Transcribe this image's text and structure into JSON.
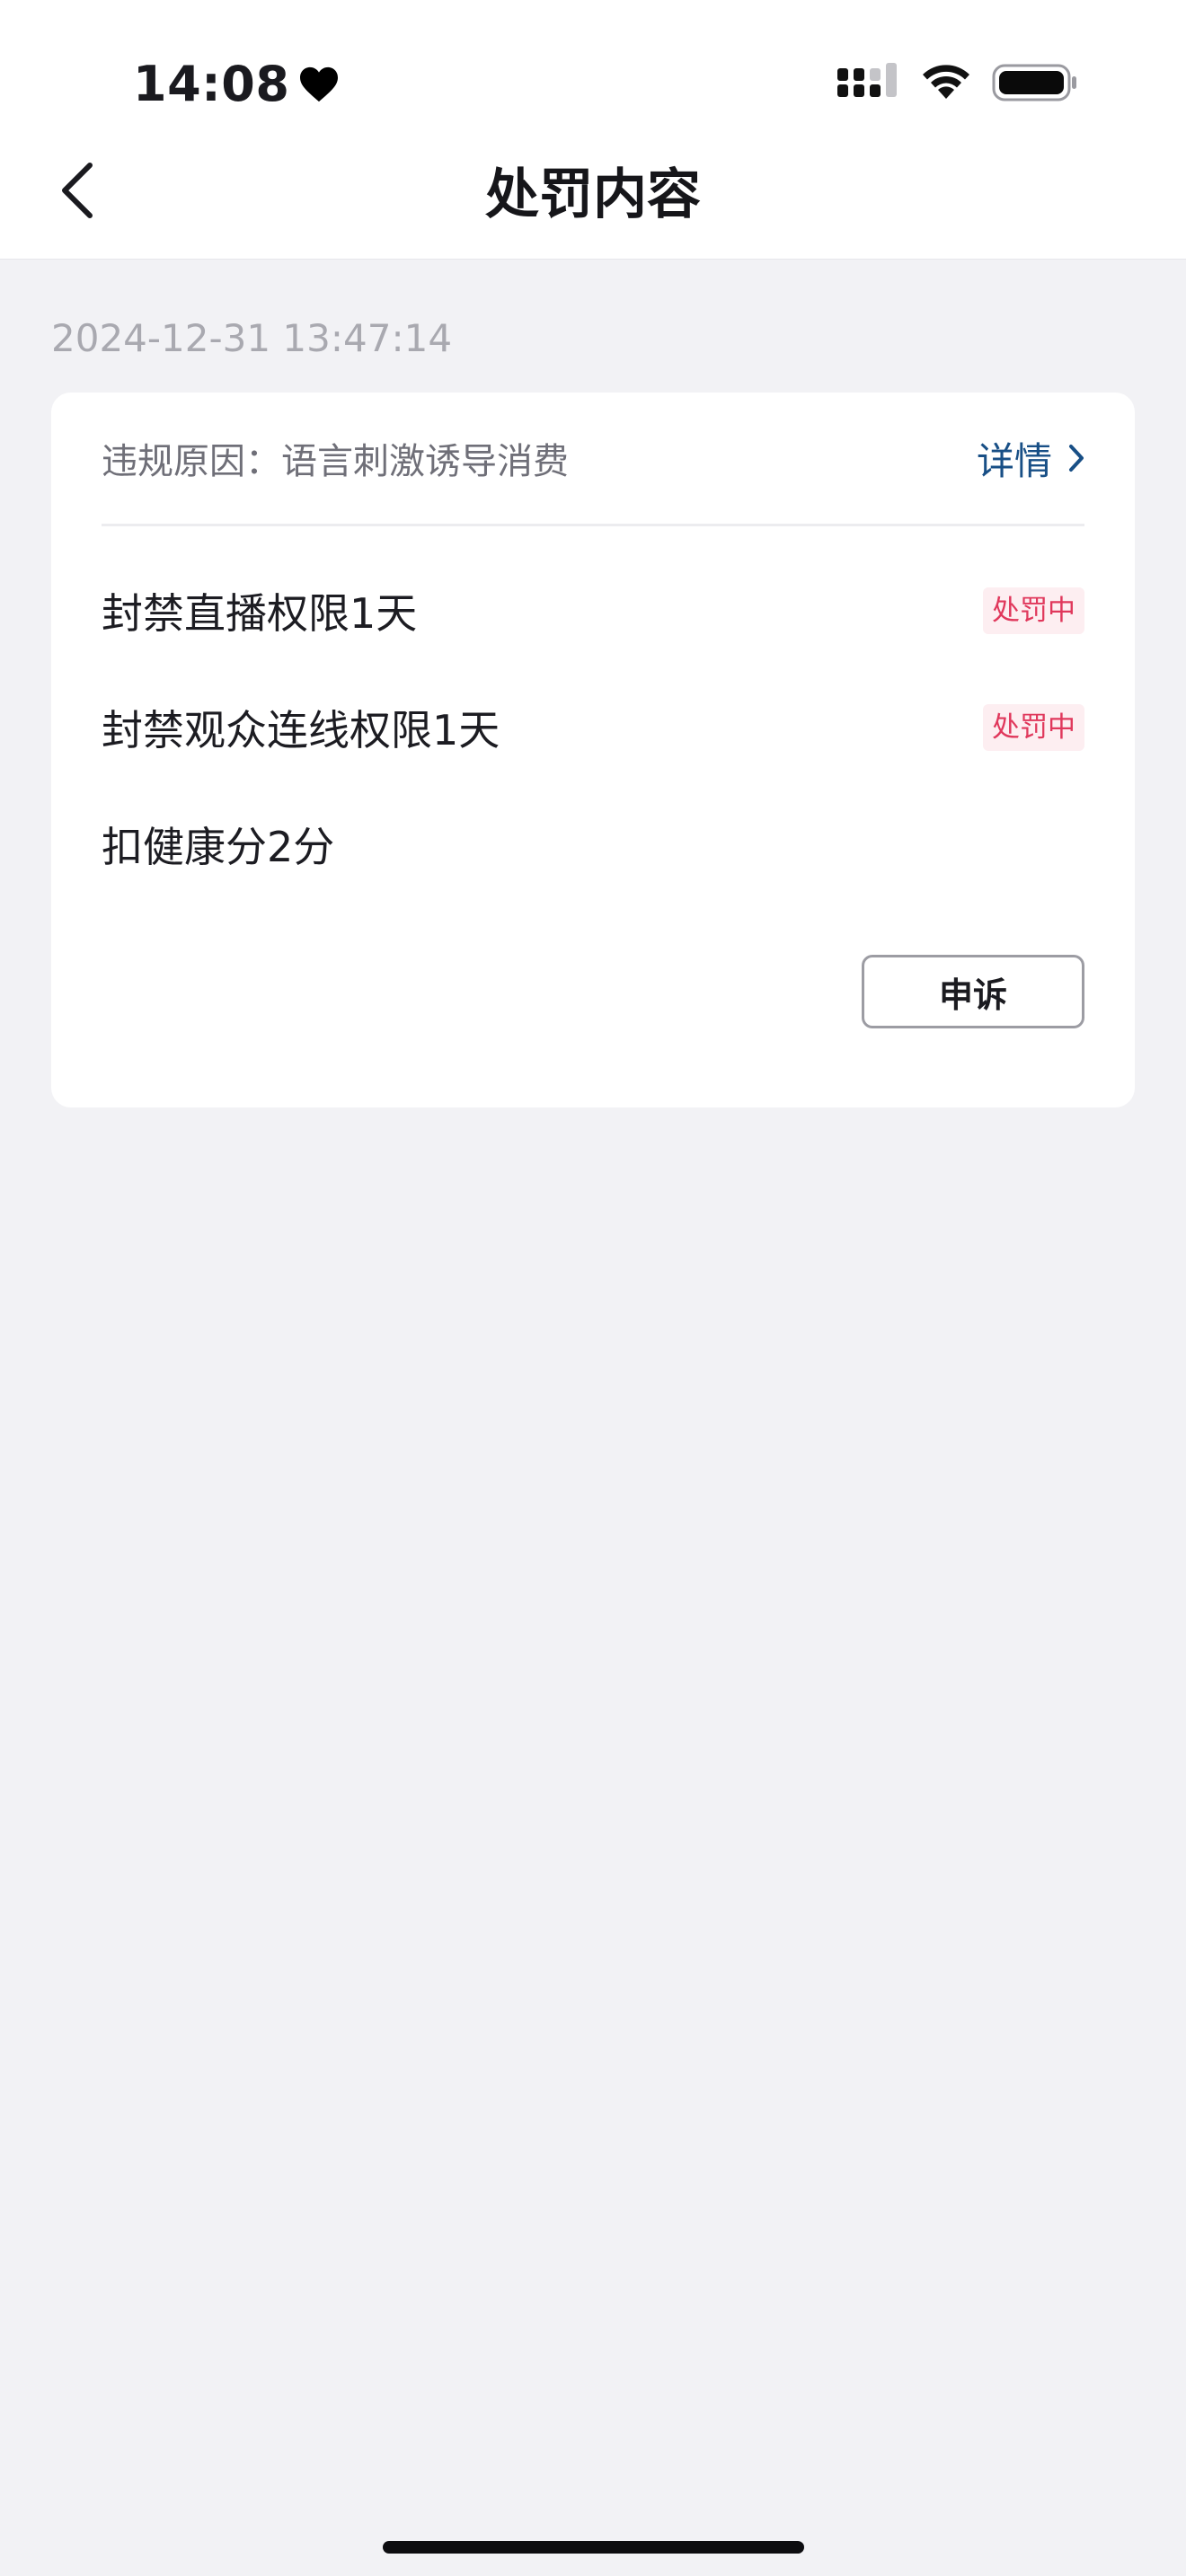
{
  "status_bar": {
    "time": "14:08"
  },
  "nav": {
    "title": "处罚内容"
  },
  "record": {
    "timestamp": "2024-12-31 13:47:14",
    "reason": "违规原因：语言刺激诱导消费",
    "detail_label": "详情",
    "penalties": [
      {
        "label": "封禁直播权限1天",
        "status": "处罚中"
      },
      {
        "label": "封禁观众连线权限1天",
        "status": "处罚中"
      },
      {
        "label": "扣健康分2分",
        "status": ""
      }
    ],
    "appeal_label": "申诉"
  },
  "colors": {
    "accent_link": "#184f86",
    "status_badge_text": "#e0385c",
    "status_badge_bg": "#fdeef1",
    "page_bg": "#f2f2f5"
  }
}
